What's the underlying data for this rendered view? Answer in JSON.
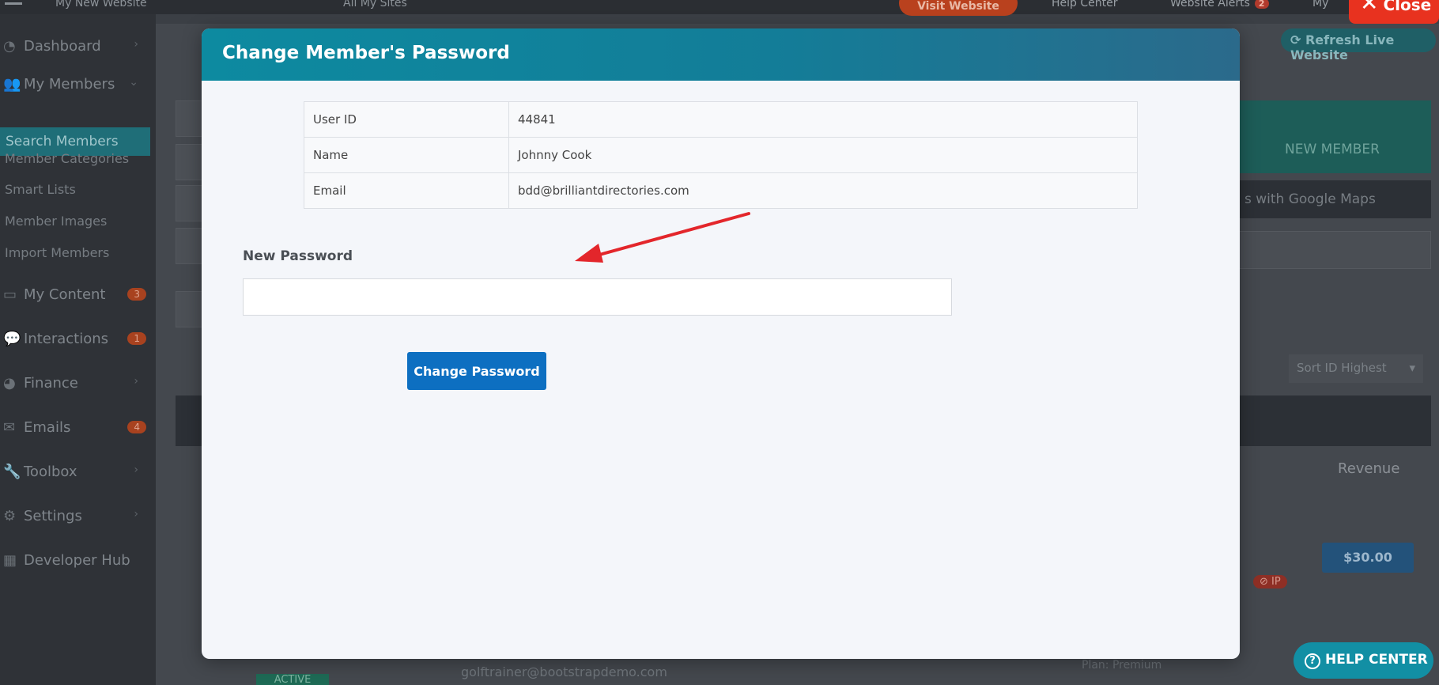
{
  "topbar": {
    "site_name": "My New Website",
    "all_sites": "All My Sites",
    "visit_website": "Visit Website",
    "help_center": "Help Center",
    "website_alerts": "Website Alerts",
    "alerts_count": "2",
    "account": "My"
  },
  "close_button": {
    "label": "Close"
  },
  "refresh_live": "Refresh Live Website",
  "sidebar": {
    "items": [
      {
        "label": "Dashboard",
        "icon": "speedometer-icon"
      },
      {
        "label": "My Members",
        "icon": "users-icon"
      },
      {
        "label": "My Content",
        "icon": "folder-icon",
        "badge": "3"
      },
      {
        "label": "Interactions",
        "icon": "chat-icon",
        "badge": "1"
      },
      {
        "label": "Finance",
        "icon": "pie-chart-icon"
      },
      {
        "label": "Emails",
        "icon": "inbox-icon",
        "badge": "4"
      },
      {
        "label": "Toolbox",
        "icon": "wrench-icon"
      },
      {
        "label": "Settings",
        "icon": "gear-icon"
      },
      {
        "label": "Developer Hub",
        "icon": "grid-icon"
      }
    ],
    "subitems": [
      "Search Members",
      "Member Categories",
      "Smart Lists",
      "Member Images",
      "Import Members"
    ]
  },
  "background": {
    "new_member": "NEW MEMBER",
    "google_maps": "s with Google Maps",
    "sort": "Sort ID Highest",
    "revenue_header": "Revenue",
    "price": "$30.00",
    "ip_badge": "IP",
    "status": "ACTIVE",
    "email": "golftrainer@bootstrapdemo.com",
    "plan_label": "Plan:",
    "plan_value": "Premium"
  },
  "modal": {
    "title": "Change Member's Password",
    "rows": [
      {
        "key": "User ID",
        "value": "44841"
      },
      {
        "key": "Name",
        "value": "Johnny Cook"
      },
      {
        "key": "Email",
        "value": "bdd@brilliantdirectories.com"
      }
    ],
    "new_password_label": "New Password",
    "new_password_value": "",
    "new_password_placeholder": "",
    "submit_label": "Change Password"
  },
  "help_center_button": {
    "label": "HELP CENTER"
  },
  "colors": {
    "modal_header": "#0d8aa0",
    "submit": "#0d6fc1",
    "close": "#e8321f",
    "arrow": "#e3262b"
  }
}
